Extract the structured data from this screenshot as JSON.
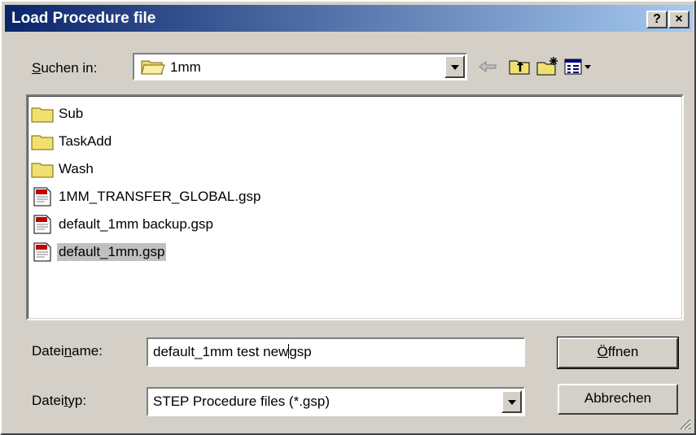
{
  "window": {
    "title": "Load Procedure file"
  },
  "titlebar": {
    "help_label": "?",
    "close_label": "×"
  },
  "lookin": {
    "label_pre": "S",
    "label_rest": "uchen in:",
    "value": "1mm"
  },
  "toolbar": {
    "back_icon": "back-arrow-icon",
    "up_icon": "up-folder-icon",
    "new_folder_icon": "new-folder-icon",
    "view_icon": "view-menu-icon"
  },
  "files": [
    {
      "name": "Sub",
      "type": "folder"
    },
    {
      "name": "TaskAdd",
      "type": "folder"
    },
    {
      "name": "Wash",
      "type": "folder"
    },
    {
      "name": "1MM_TRANSFER_GLOBAL.gsp",
      "type": "doc"
    },
    {
      "name": "default_1mm backup.gsp",
      "type": "doc"
    },
    {
      "name": "default_1mm.gsp",
      "type": "doc",
      "selected": true
    }
  ],
  "filename": {
    "label_pre": "Datei",
    "label_u": "n",
    "label_rest": "ame:",
    "value_before_caret": "default_1mm test new",
    "value_after_caret": "gsp"
  },
  "filetype": {
    "label_pre": "Datei",
    "label_u": "t",
    "label_rest": "yp:",
    "value": "STEP Procedure files (*.gsp)"
  },
  "buttons": {
    "open_u": "Ö",
    "open_rest": "ffnen",
    "cancel": "Abbrechen"
  }
}
